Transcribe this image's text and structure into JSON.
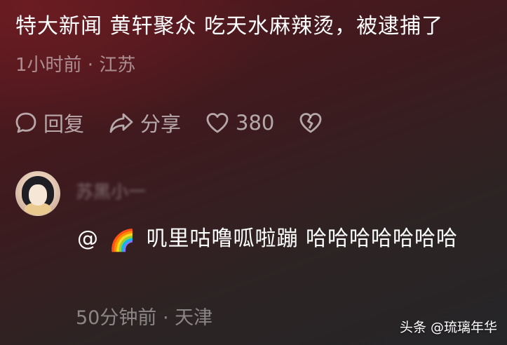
{
  "post": {
    "title": "特大新闻 黄轩聚众 吃天水麻辣烫，被逮捕了",
    "meta": "1小时前 · 江苏"
  },
  "actions": {
    "reply_label": "回复",
    "share_label": "分享",
    "like_count": "380",
    "icons": {
      "reply": "comment-bubble-icon",
      "share": "share-arrow-icon",
      "like": "heart-icon",
      "dislike": "broken-heart-icon"
    }
  },
  "comment": {
    "username": "苏黑小一",
    "mention": "@",
    "emoji": "🌈",
    "text": "叽里咕噜呱啦蹦 哈哈哈哈哈哈哈",
    "meta": "50分钟前 · 天津"
  },
  "watermark": "头条 @琉璃年华",
  "colors": {
    "background_top": "#55181e",
    "background_bottom": "#252528",
    "text_primary": "#ffffff"
  }
}
